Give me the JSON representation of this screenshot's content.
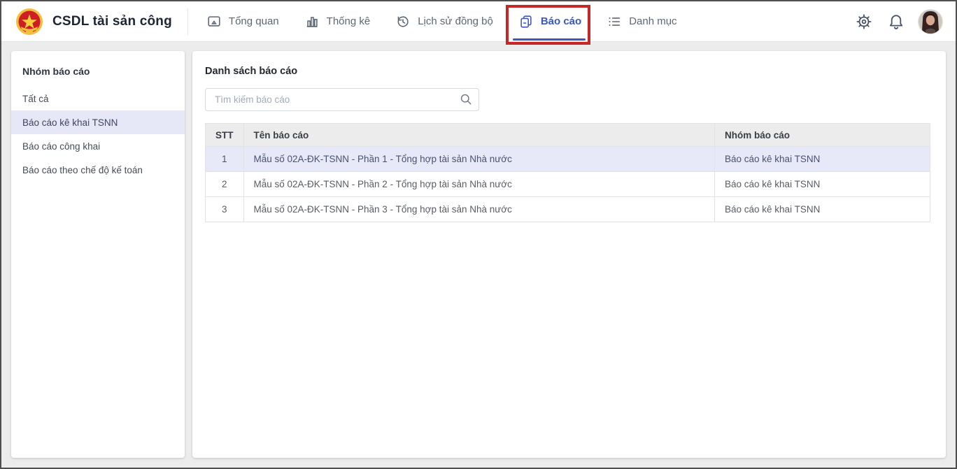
{
  "app": {
    "title": "CSDL tài sản công"
  },
  "colors": {
    "accent_blue": "#3a57c4",
    "annotation_red": "#c32727",
    "selected_row_bg": "#e7e9f8",
    "selected_sidebar_bg": "#e6e8f7",
    "table_header_bg": "#ececec"
  },
  "nav": {
    "items": [
      {
        "label": "Tổng quan",
        "icon": "overview-icon",
        "active": false
      },
      {
        "label": "Thống kê",
        "icon": "statistics-icon",
        "active": false
      },
      {
        "label": "Lịch sử đồng bộ",
        "icon": "sync-history-icon",
        "active": false
      },
      {
        "label": "Báo cáo",
        "icon": "report-icon",
        "active": true,
        "annotated": true
      },
      {
        "label": "Danh mục",
        "icon": "catalog-icon",
        "active": false
      }
    ]
  },
  "header_actions": {
    "settings_icon": "gear-icon",
    "notifications_icon": "bell-icon",
    "avatar": "user-avatar"
  },
  "sidebar": {
    "title": "Nhóm báo cáo",
    "items": [
      {
        "label": "Tất cả",
        "selected": false
      },
      {
        "label": "Báo cáo kê khai TSNN",
        "selected": true
      },
      {
        "label": "Báo cáo công khai",
        "selected": false
      },
      {
        "label": "Báo cáo theo chế độ kế toán",
        "selected": false
      }
    ]
  },
  "main": {
    "title": "Danh sách báo cáo",
    "search_placeholder": "Tìm kiếm báo cáo",
    "table": {
      "columns": {
        "stt": "STT",
        "name": "Tên báo cáo",
        "group": "Nhóm báo cáo"
      },
      "rows": [
        {
          "stt": "1",
          "name": "Mẫu số 02A-ĐK-TSNN - Phần 1 - Tổng hợp tài sản Nhà nước",
          "group": "Báo cáo kê khai TSNN",
          "selected": true
        },
        {
          "stt": "2",
          "name": "Mẫu số 02A-ĐK-TSNN - Phần 2 - Tổng hợp tài sản Nhà nước",
          "group": "Báo cáo kê khai TSNN",
          "selected": false
        },
        {
          "stt": "3",
          "name": "Mẫu số 02A-ĐK-TSNN - Phần 3 - Tổng hợp tài sản Nhà nước",
          "group": "Báo cáo kê khai TSNN",
          "selected": false
        }
      ]
    }
  }
}
